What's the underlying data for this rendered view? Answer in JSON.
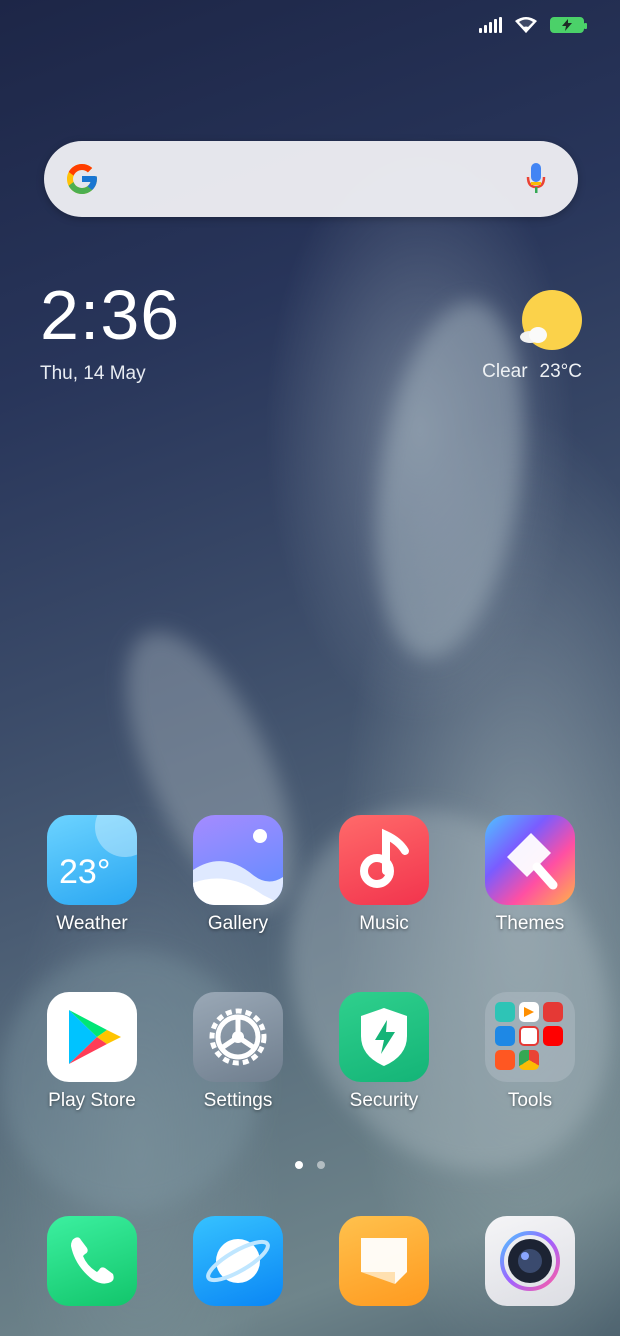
{
  "status_bar": {
    "signal": "signal-icon",
    "wifi": "wifi-icon",
    "battery": "battery-charging-icon"
  },
  "search": {
    "logo": "google-g-icon",
    "mic": "mic-icon"
  },
  "clock": {
    "time": "2:36",
    "date": "Thu, 14 May"
  },
  "weather": {
    "condition": "Clear",
    "temperature": "23°C"
  },
  "apps_row1": [
    {
      "label": "Weather",
      "icon": "weather-icon",
      "icon_text": "23°"
    },
    {
      "label": "Gallery",
      "icon": "gallery-icon"
    },
    {
      "label": "Music",
      "icon": "music-icon"
    },
    {
      "label": "Themes",
      "icon": "themes-icon"
    }
  ],
  "apps_row2": [
    {
      "label": "Play Store",
      "icon": "play-store-icon"
    },
    {
      "label": "Settings",
      "icon": "settings-icon"
    },
    {
      "label": "Security",
      "icon": "security-icon"
    },
    {
      "label": "Tools",
      "icon": "tools-folder-icon"
    }
  ],
  "page_indicator": {
    "pages": 2,
    "current": 1
  },
  "dock": [
    {
      "icon": "phone-icon"
    },
    {
      "icon": "browser-icon"
    },
    {
      "icon": "messages-icon"
    },
    {
      "icon": "camera-icon"
    }
  ],
  "colors": {
    "battery": "#4bd169",
    "sun": "#fbd24a"
  }
}
